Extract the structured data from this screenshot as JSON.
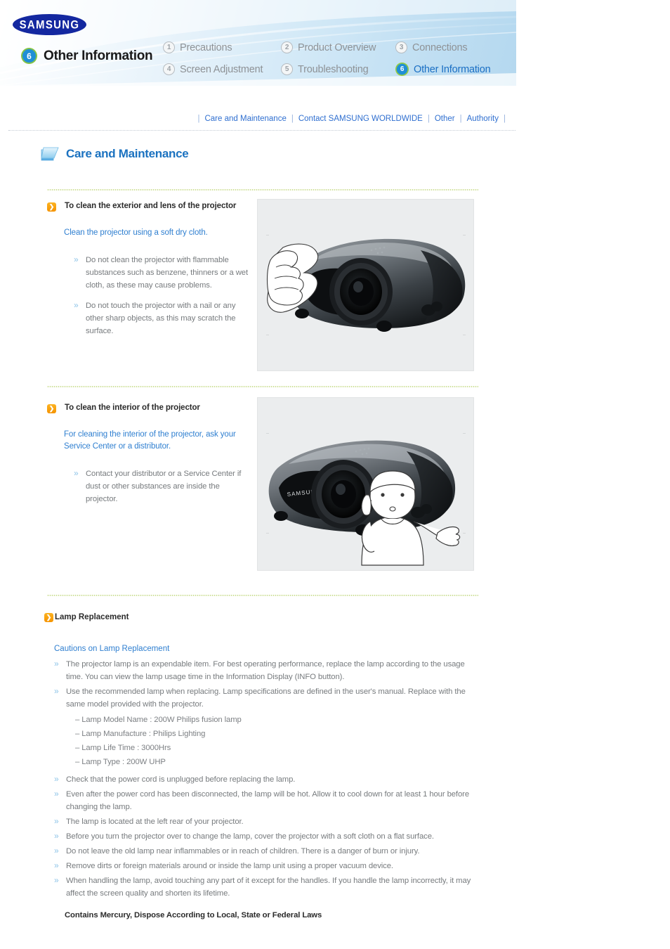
{
  "brand": {
    "logo_text": "SAMSUNG"
  },
  "header": {
    "current_section_number": "6",
    "current_section_title": "Other Information",
    "nav": [
      {
        "num": "1",
        "label": "Precautions",
        "active": false
      },
      {
        "num": "2",
        "label": "Product Overview",
        "active": false
      },
      {
        "num": "3",
        "label": "Connections",
        "active": false
      },
      {
        "num": "4",
        "label": "Screen Adjustment",
        "active": false
      },
      {
        "num": "5",
        "label": "Troubleshooting",
        "active": false
      },
      {
        "num": "6",
        "label": "Other Information",
        "active": true
      }
    ]
  },
  "subnav": {
    "items": [
      "Care and Maintenance",
      "Contact SAMSUNG WORLDWIDE",
      "Other",
      "Authority"
    ],
    "separator": "|"
  },
  "page": {
    "title": "Care and Maintenance",
    "title_icon": "folder-icon"
  },
  "sections": [
    {
      "heading": "To clean the exterior and lens of the projector",
      "lead": "Clean the projector using a soft dry cloth.",
      "bullets": [
        "Do not clean the projector with flammable substances such as benzene, thinners or a wet cloth, as these may cause problems.",
        "Do not touch the projector with a nail or any other sharp objects, as this may scratch the surface."
      ],
      "image_alt": "Hand wiping the projector with a cloth"
    },
    {
      "heading": "To clean the interior of the projector",
      "lead": "For cleaning the interior of the projector, ask your Service Center or a distributor.",
      "bullets": [
        "Contact your distributor or a Service Center if dust or other substances are inside the projector."
      ],
      "image_alt": "Person calling a service center beside the projector"
    }
  ],
  "lamp": {
    "heading": "Lamp Replacement",
    "subheading": "Cautions on Lamp Replacement",
    "bullets": [
      "The projector lamp is an expendable item. For best operating performance, replace the lamp according to the usage time. You can view the lamp usage time in the Information Display (INFO button).",
      "Use the recommended lamp when replacing. Lamp specifications are defined in the user's manual. Replace with the same model provided with the projector.",
      "Check that the power cord is unplugged before replacing the lamp.",
      "Even after the power cord has been disconnected, the lamp will be hot. Allow it to cool down for at least 1 hour before changing the lamp.",
      "The lamp is located at the left rear of your projector.",
      "Before you turn the projector over to change the lamp, cover the projector with a soft cloth on a flat surface.",
      "Do not leave the old lamp near inflammables or in reach of children. There is a danger of burn or injury.",
      "Remove dirts or foreign materials around or inside the lamp unit using a proper vacuum device.",
      "When handling the lamp, avoid touching any part of it except for the handles. If you handle the lamp incorrectly, it may affect the screen quality and shorten its lifetime."
    ],
    "specs": [
      "– Lamp Model Name : 200W Philips fusion lamp",
      "– Lamp Manufacture : Philips Lighting",
      "– Lamp Life Time : 3000Hrs",
      "– Lamp Type : 200W UHP"
    ],
    "notice": "Contains Mercury, Dispose According to Local, State or Federal Laws"
  },
  "colors": {
    "accent_blue": "#2f7fd0",
    "link_blue": "#2f6fd0",
    "orange_marker": "#f59300",
    "samsung_navy": "#1428a0",
    "body_gray": "#777b7e",
    "dotted_green": "#cfe09a"
  }
}
